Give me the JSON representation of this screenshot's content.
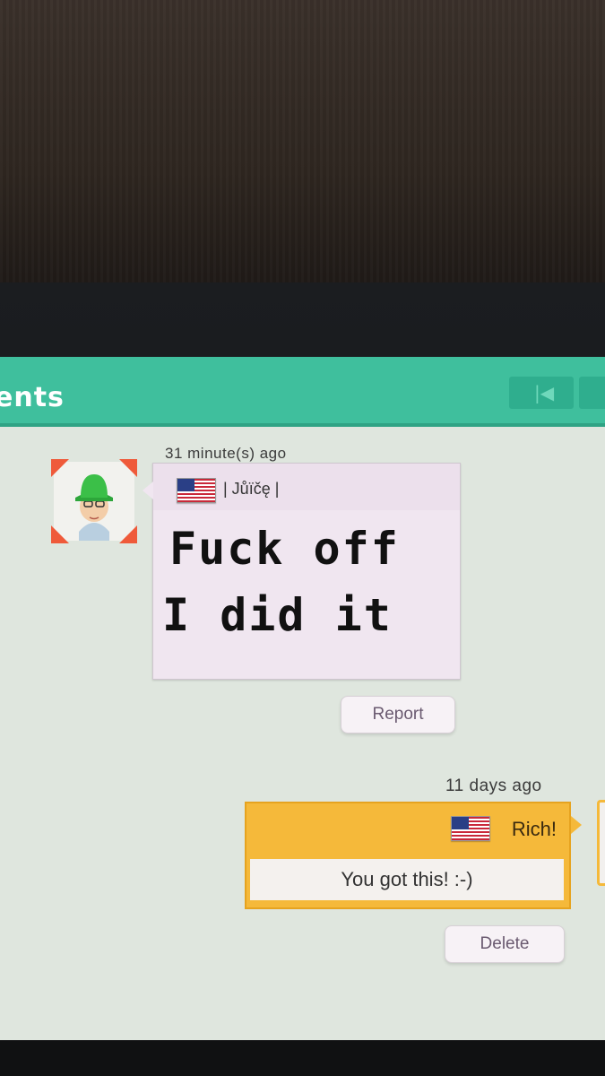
{
  "header": {
    "title": "ents"
  },
  "post": {
    "timestamp": "31 minute(s) ago",
    "username": "| Jůïčę |",
    "drawing_text_line1": "Fuck off",
    "drawing_text_line2": "I did it",
    "report_label": "Report"
  },
  "reply": {
    "timestamp": "11 days ago",
    "username": "Rich!",
    "message": "You got this! :-)",
    "delete_label": "Delete"
  },
  "colors": {
    "header": "#3fbf9d",
    "background": "#dfe6de",
    "post_card": "#f0e6f0",
    "reply_card": "#f5b93a",
    "avatar_corner": "#ef5a3a"
  },
  "icons": [
    "us-flag-icon",
    "mii-avatar-icon"
  ]
}
